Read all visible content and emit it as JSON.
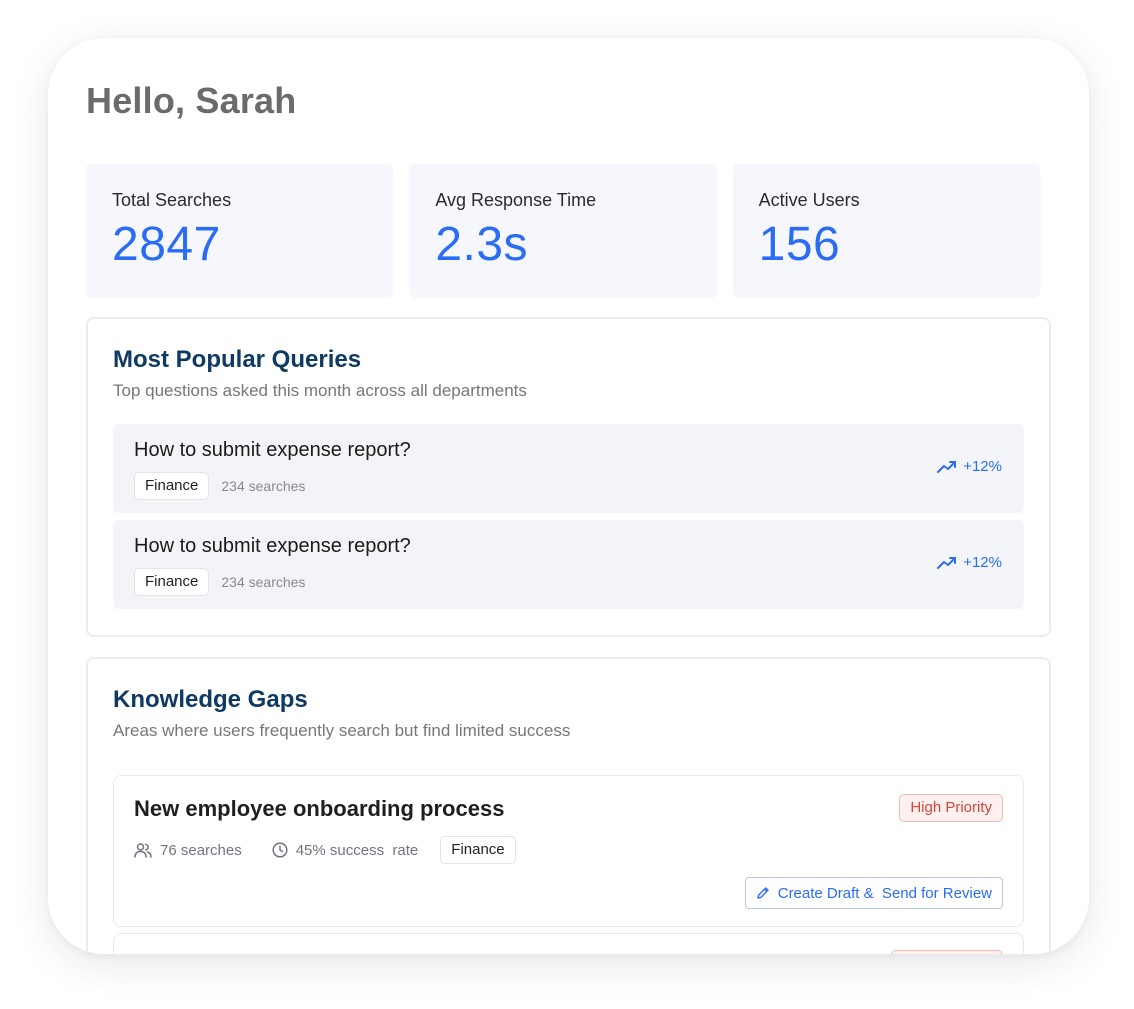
{
  "greeting": "Hello, Sarah",
  "stats": [
    {
      "label": "Total Searches",
      "value": "2847"
    },
    {
      "label": "Avg Response Time",
      "value": "2.3s"
    },
    {
      "label": "Active Users",
      "value": "156"
    }
  ],
  "popular": {
    "title": "Most Popular Queries",
    "subtitle": "Top questions asked this month across all departments",
    "items": [
      {
        "question": "How to submit expense report?",
        "department": "Finance",
        "searches": "234 searches",
        "trend": "+12%",
        "trend_icon": "trending-up-icon"
      },
      {
        "question": "How to submit expense report?",
        "department": "Finance",
        "searches": "234 searches",
        "trend": "+12%",
        "trend_icon": "trending-up-icon"
      }
    ]
  },
  "gaps": {
    "title": "Knowledge Gaps",
    "subtitle": "Areas where users frequently search but find limited success",
    "items": [
      {
        "topic": "New employee onboarding process",
        "priority": "High Priority",
        "searches": "76 searches",
        "success": "45% success  rate",
        "department": "Finance",
        "action": "Create Draft &  Send for Review"
      }
    ]
  },
  "colors": {
    "accent": "#2a6df4",
    "heading": "#0e3a63",
    "priority_text": "#d0473a",
    "priority_bg": "#fdf0ee"
  }
}
